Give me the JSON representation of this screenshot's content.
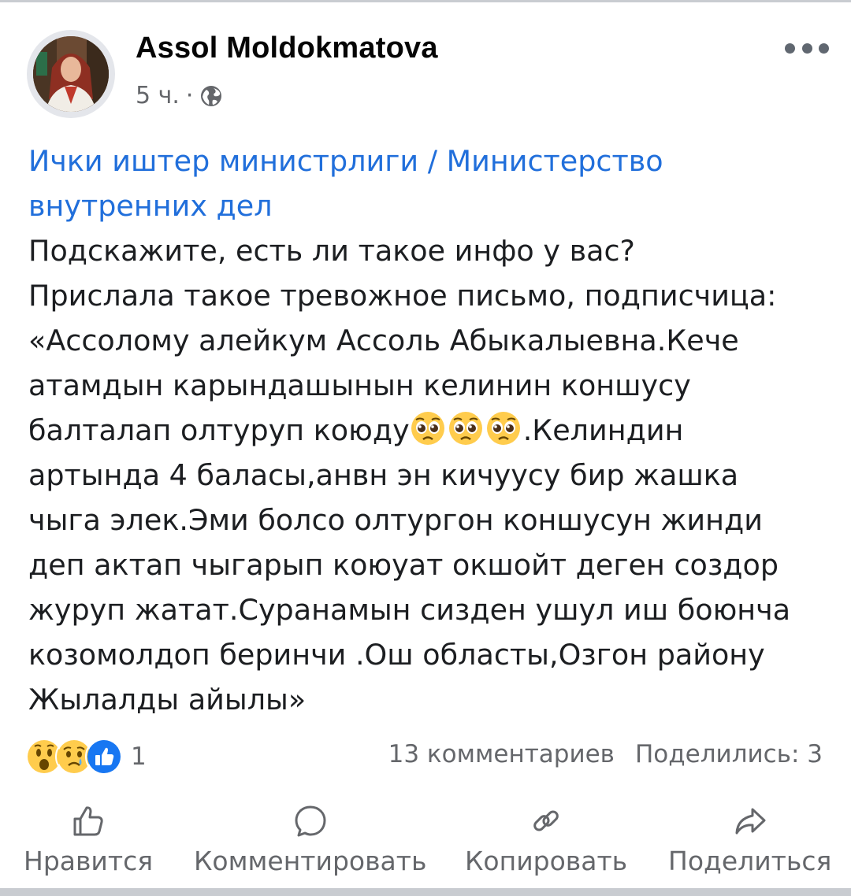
{
  "post": {
    "author": "Assol Moldokmatova",
    "time": "5 ч.",
    "separator": "·",
    "audience_icon": "globe-icon",
    "more_icon": "more-options-icon",
    "mention": [
      "Ички иштер министрлиги / Министерство",
      "внутренних дел"
    ],
    "lines": [
      "Подскажите, есть ли такое инфо у вас?",
      "Прислала такое тревожное письмо, подписчица:",
      "«Ассолому алейкум Ассоль Абыкалыевна.Кече",
      "атамдын карындашынын келинин коншусу"
    ],
    "emoji_line_prefix": "балталап олтуруп коюду",
    "emoji_line_suffix": ".Келиндин",
    "emoji_name": "pleading-face-emoji",
    "lines_after": [
      "артында 4 баласы,анвн эн кичуусу бир жашка",
      "чыга элек.Эми болсо олтургон коншусун жинди",
      "деп актап чыгарып коюуат окшойт деген создор",
      "журуп жатат.Суранамын сизден ушул иш боюнча",
      "козомолдоп беринчи .Ош областы,Озгон району",
      "Жылалды айылы»"
    ]
  },
  "reactions": {
    "icons": [
      "wow-reaction-icon",
      "sad-reaction-icon",
      "like-reaction-icon"
    ],
    "count": "1"
  },
  "stats": {
    "comments": "13 комментариев",
    "shares": "Поделились: 3"
  },
  "actions": {
    "like": "Нравится",
    "comment": "Комментировать",
    "copy": "Копировать",
    "share": "Поделиться"
  },
  "colors": {
    "mention": "#216fdb",
    "secondary_text": "#65676b",
    "like_blue": "#1877f2",
    "emoji_yellow": "#ffcc4d"
  }
}
